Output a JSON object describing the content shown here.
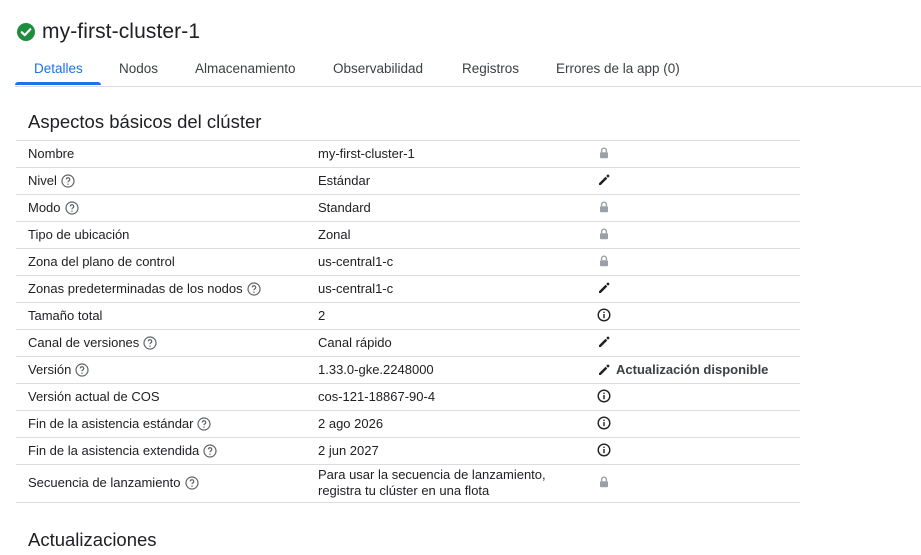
{
  "header": {
    "title": "my-first-cluster-1"
  },
  "tabs": [
    {
      "label": "Detalles"
    },
    {
      "label": "Nodos"
    },
    {
      "label": "Almacenamiento"
    },
    {
      "label": "Observabilidad"
    },
    {
      "label": "Registros"
    },
    {
      "label": "Errores de la app (0)"
    }
  ],
  "active_tab": "Detalles",
  "basics": {
    "title": "Aspectos básicos del clúster",
    "rows": [
      {
        "label": "Nombre",
        "value": "my-first-cluster-1",
        "action_icon": "lock-icon"
      },
      {
        "label": "Nivel",
        "value": "Estándar",
        "action_icon": "edit-icon"
      },
      {
        "label": "Modo",
        "value": "Standard",
        "action_icon": "lock-icon"
      },
      {
        "label": "Tipo de ubicación",
        "value": "Zonal",
        "action_icon": "lock-icon"
      },
      {
        "label": "Zona del plano de control",
        "value": "us-central1-c",
        "action_icon": "lock-icon"
      },
      {
        "label": "Zonas predeterminadas de los nodos",
        "value": "us-central1-c",
        "action_icon": "edit-icon"
      },
      {
        "label": "Tamaño total",
        "value": "2",
        "action_icon": "info-icon"
      },
      {
        "label": "Canal de versiones",
        "value": "Canal rápido",
        "action_icon": "edit-icon"
      },
      {
        "label": "Versión",
        "value": "1.33.0-gke.2248000",
        "action_icon": "edit-icon",
        "action_text": "Actualización disponible"
      },
      {
        "label": "Versión actual de COS",
        "value": "cos-121-18867-90-4",
        "action_icon": "info-icon"
      },
      {
        "label": "Fin de la asistencia estándar",
        "value": "2 ago 2026",
        "action_icon": "info-icon"
      },
      {
        "label": "Fin de la asistencia extendida",
        "value": "2 jun 2027",
        "action_icon": "info-icon"
      },
      {
        "label": "Secuencia de lanzamiento",
        "value_line1": "Para usar la secuencia de lanzamiento,",
        "value_line2": "registra tu clúster en una flota",
        "action_icon": "lock-icon"
      }
    ]
  },
  "updates": {
    "title": "Actualizaciones"
  },
  "colors": {
    "accent": "#1a73e8",
    "success": "#1e8e3e",
    "text": "#202124",
    "muted_icon": "#9aa0a6",
    "divider": "#dadce0"
  }
}
